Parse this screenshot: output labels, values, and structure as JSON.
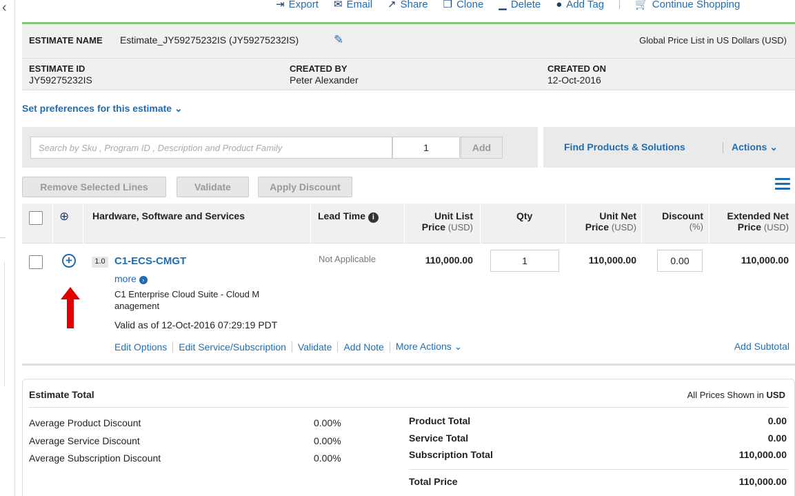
{
  "toolbar": {
    "items": [
      "Export",
      "Email",
      "Share",
      "Clone",
      "Delete",
      "Add Tag",
      "Continue Shopping"
    ]
  },
  "estimate": {
    "name_label": "ESTIMATE NAME",
    "name_value": "Estimate_JY59275232IS (JY59275232IS)",
    "price_list": "Global Price List in US Dollars (USD)",
    "id_label": "ESTIMATE ID",
    "id_value": "JY59275232IS",
    "created_by_label": "CREATED BY",
    "created_by_value": "Peter Alexander",
    "created_on_label": "CREATED ON",
    "created_on_value": "12-Oct-2016"
  },
  "preferences_link": "Set preferences for this estimate",
  "search": {
    "placeholder": "Search by Sku , Program ID , Description and Product Family",
    "qty": "1",
    "add_label": "Add",
    "find_label": "Find Products & Solutions",
    "actions_label": "Actions"
  },
  "buttons": {
    "remove": "Remove Selected Lines",
    "validate": "Validate",
    "apply_discount": "Apply Discount"
  },
  "table": {
    "col_product": "Hardware, Software and Services",
    "col_lead": "Lead Time",
    "col_unit_list_1": "Unit List",
    "col_unit_list_2": "Price",
    "col_qty": "Qty",
    "col_unit_net_1": "Unit Net",
    "col_unit_net_2": "Price",
    "col_discount_1": "Discount",
    "col_discount_2": "(%)",
    "col_ext_1": "Extended Net",
    "col_ext_2": "Price",
    "currency": "(USD)"
  },
  "line": {
    "number": "1.0",
    "sku": "C1-ECS-CMGT",
    "more": "more",
    "description": "C1 Enterprise Cloud Suite - Cloud M anagement",
    "valid": "Valid as of 12-Oct-2016 07:29:19 PDT",
    "lead_time": "Not Applicable",
    "unit_list": "110,000.00",
    "qty": "1",
    "unit_net": "110,000.00",
    "discount": "0.00",
    "extended": "110,000.00",
    "links": [
      "Edit Options",
      "Edit Service/Subscription",
      "Validate",
      "Add Note",
      "More Actions"
    ],
    "add_subtotal": "Add Subtotal"
  },
  "totals": {
    "title": "Estimate Total",
    "note_prefix": "All Prices Shown in",
    "note_currency": "USD",
    "avg_product_label": "Average Product Discount",
    "avg_product_val": "0.00%",
    "avg_service_label": "Average Service Discount",
    "avg_service_val": "0.00%",
    "avg_sub_label": "Average Subscription Discount",
    "avg_sub_val": "0.00%",
    "product_total_label": "Product Total",
    "product_total_val": "0.00",
    "service_total_label": "Service Total",
    "service_total_val": "0.00",
    "sub_total_label": "Subscription Total",
    "sub_total_val": "110,000.00",
    "total_price_label": "Total Price",
    "total_price_val": "110,000.00"
  },
  "colors": {
    "link": "#1e6db3",
    "accent_line": "#7fc47a",
    "annotation_arrow": "#e00000"
  }
}
